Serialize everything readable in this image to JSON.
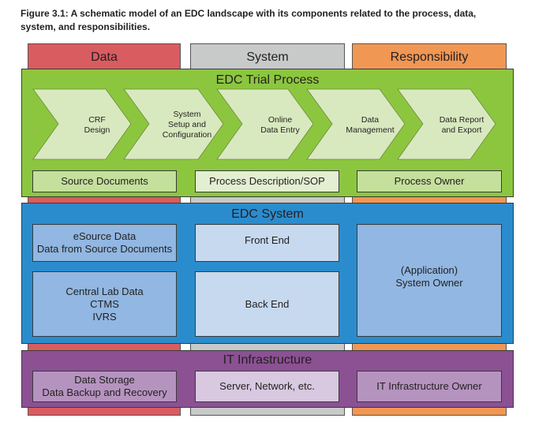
{
  "caption": "Figure 3.1: A schematic model of an EDC landscape with its components related to the process, data, system, and responsibilities.",
  "columns": [
    {
      "label": "Data",
      "color": "#d95c60"
    },
    {
      "label": "System",
      "color": "#c8c9c9"
    },
    {
      "label": "Responsibility",
      "color": "#f09754"
    }
  ],
  "trial_process": {
    "title": "EDC Trial Process",
    "color": "#8cc63f",
    "steps": [
      {
        "line1": "CRF",
        "line2": "Design",
        "line3": ""
      },
      {
        "line1": "System",
        "line2": "Setup and",
        "line3": "Configuration"
      },
      {
        "line1": "Online",
        "line2": "Data Entry",
        "line3": ""
      },
      {
        "line1": "Data",
        "line2": "Management",
        "line3": ""
      },
      {
        "line1": "Data Report",
        "line2": "and Export",
        "line3": ""
      }
    ],
    "boxes": [
      {
        "label": "Source Documents"
      },
      {
        "label": "Process Description/SOP"
      },
      {
        "label": "Process Owner"
      }
    ]
  },
  "edc_system": {
    "title": "EDC System",
    "color": "#2b8ccd",
    "data_top": {
      "line1": "eSource Data",
      "line2": "Data from Source Documents"
    },
    "data_bottom": {
      "line1": "Central Lab Data",
      "line2": "CTMS",
      "line3": "IVRS"
    },
    "front_end": "Front End",
    "back_end": "Back End",
    "owner": {
      "line1": "(Application)",
      "line2": "System Owner"
    }
  },
  "it_infrastructure": {
    "title": "IT Infrastructure",
    "color": "#8b5193",
    "data": {
      "line1": "Data Storage",
      "line2": "Data Backup and Recovery"
    },
    "system": "Server, Network, etc.",
    "owner": "IT Infrastructure Owner"
  }
}
